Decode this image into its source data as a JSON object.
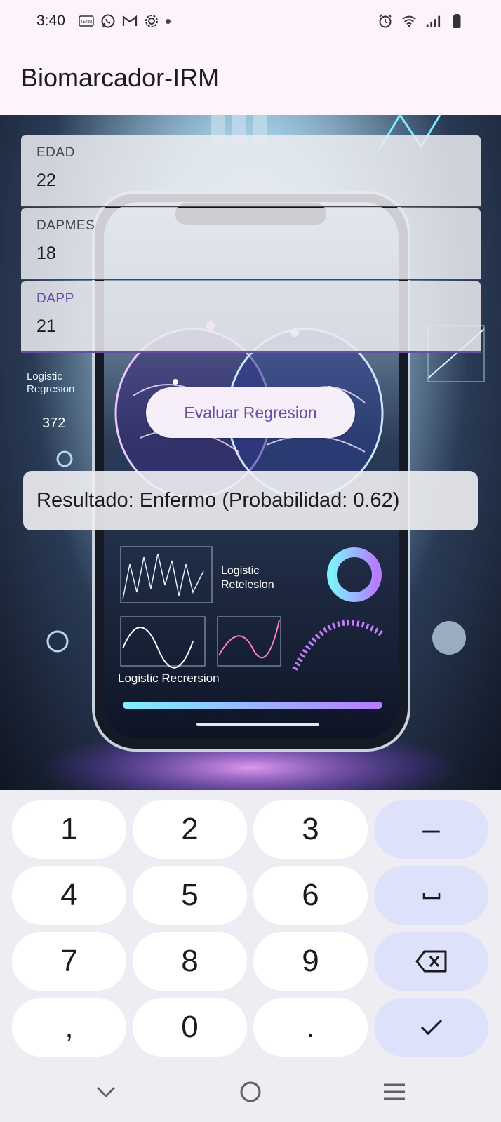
{
  "status_bar": {
    "time": "3:40",
    "left_icons": [
      "temu-icon",
      "whatsapp-icon",
      "gmail-icon",
      "settings-icon",
      "notification-dot"
    ],
    "right_icons": [
      "alarm-icon",
      "wifi-icon",
      "signal-icon",
      "battery-icon"
    ]
  },
  "app_bar": {
    "title": "Biomarcador-IRM"
  },
  "fields": [
    {
      "label": "EDAD",
      "value": "22"
    },
    {
      "label": "DAPMES",
      "value": "18"
    },
    {
      "label": "DAPP",
      "value": "21"
    }
  ],
  "evaluate_button": {
    "label": "Evaluar Regresion"
  },
  "result": {
    "text": "Resultado: Enfermo (Probabilidad: 0.62)"
  },
  "background_image": {
    "texts": [
      "Logistic Regresion",
      "Logistic Reteleslon",
      "Logistic Recrersion",
      "372"
    ]
  },
  "keyboard": {
    "rows": [
      [
        "1",
        "2",
        "3",
        "–"
      ],
      [
        "4",
        "5",
        "6",
        "␣"
      ],
      [
        "7",
        "8",
        "9",
        "⌫"
      ],
      [
        ",",
        "0",
        ".",
        "✓"
      ]
    ]
  },
  "colors": {
    "accent": "#6750a4",
    "keyboard_bg": "#eeedf4",
    "func_key": "#dde2fa",
    "app_bar": "#fcf3fb"
  }
}
